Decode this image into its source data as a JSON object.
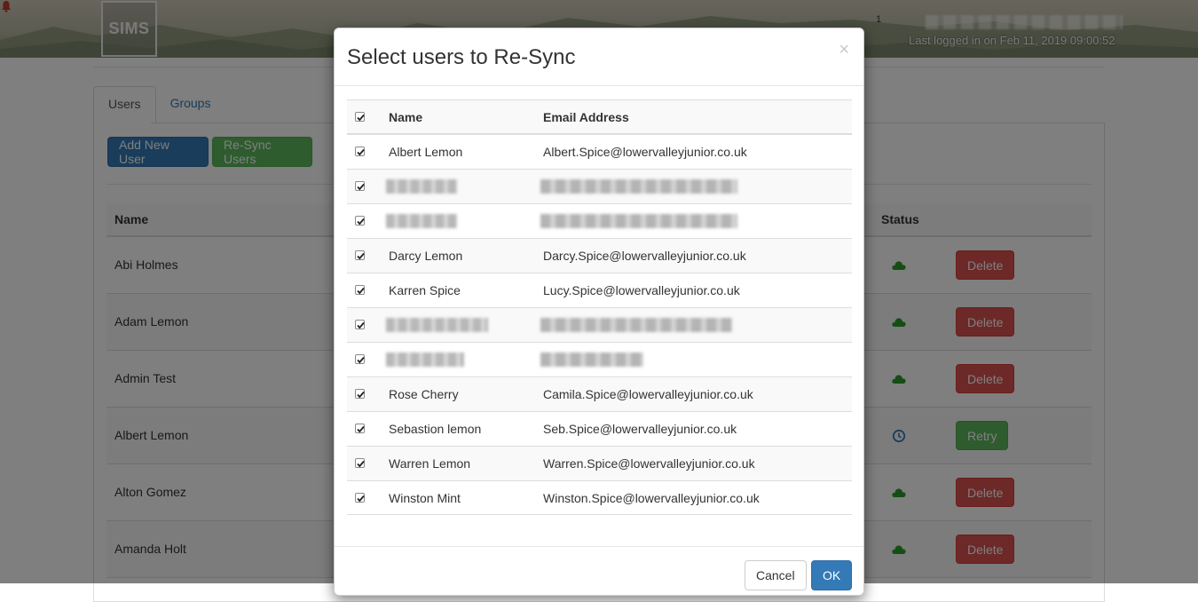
{
  "header": {
    "logo_text": "SIMS",
    "notification_count": "1",
    "last_logged_in": "Last logged in on Feb 11, 2019 09:00:52"
  },
  "tabs": [
    {
      "label": "Users",
      "active": true
    },
    {
      "label": "Groups",
      "active": false
    }
  ],
  "toolbar": {
    "add_new_user_label": "Add New User",
    "resync_users_label": "Re-Sync Users"
  },
  "users_table": {
    "columns": {
      "name": "Name",
      "status": "Status"
    },
    "rows": [
      {
        "name": "Abi Holmes",
        "status": "synced",
        "action": "Delete"
      },
      {
        "name": "Adam Lemon",
        "status": "synced",
        "action": "Delete"
      },
      {
        "name": "Admin Test",
        "status": "synced",
        "action": "Delete"
      },
      {
        "name": "Albert Lemon",
        "status": "pending",
        "action": "Retry"
      },
      {
        "name": "Alton Gomez",
        "status": "synced",
        "action": "Delete"
      },
      {
        "name": "Amanda Holt",
        "status": "synced",
        "action": "Delete"
      }
    ]
  },
  "modal": {
    "title": "Select users to Re-Sync",
    "close_symbol": "×",
    "columns": {
      "name": "Name",
      "email": "Email Address"
    },
    "select_all_checked": true,
    "rows": [
      {
        "name": "Albert Lemon",
        "email": "Albert.Spice@lowervalleyjunior.co.uk",
        "checked": true
      },
      {
        "name": "",
        "email": "",
        "checked": true,
        "redacted": true
      },
      {
        "name": "",
        "email": "",
        "checked": true,
        "redacted": true
      },
      {
        "name": "Darcy Lemon",
        "email": "Darcy.Spice@lowervalleyjunior.co.uk",
        "checked": true
      },
      {
        "name": "Karren Spice",
        "email": "Lucy.Spice@lowervalleyjunior.co.uk",
        "checked": true
      },
      {
        "name": "",
        "email": "",
        "checked": true,
        "redacted": true
      },
      {
        "name": "",
        "email": "",
        "checked": true,
        "redacted": true
      },
      {
        "name": "Rose Cherry",
        "email": "Camila.Spice@lowervalleyjunior.co.uk",
        "checked": true
      },
      {
        "name": "Sebastion lemon",
        "email": "Seb.Spice@lowervalleyjunior.co.uk",
        "checked": true
      },
      {
        "name": "Warren Lemon",
        "email": "Warren.Spice@lowervalleyjunior.co.uk",
        "checked": true
      },
      {
        "name": "Winston Mint",
        "email": "Winston.Spice@lowervalleyjunior.co.uk",
        "checked": true
      }
    ],
    "cancel_label": "Cancel",
    "ok_label": "OK"
  },
  "colors": {
    "primary": "#337ab7",
    "success": "#5cb85c",
    "danger": "#d9534f",
    "synced_icon": "#2a9d2a",
    "pending_icon": "#337ab7"
  }
}
